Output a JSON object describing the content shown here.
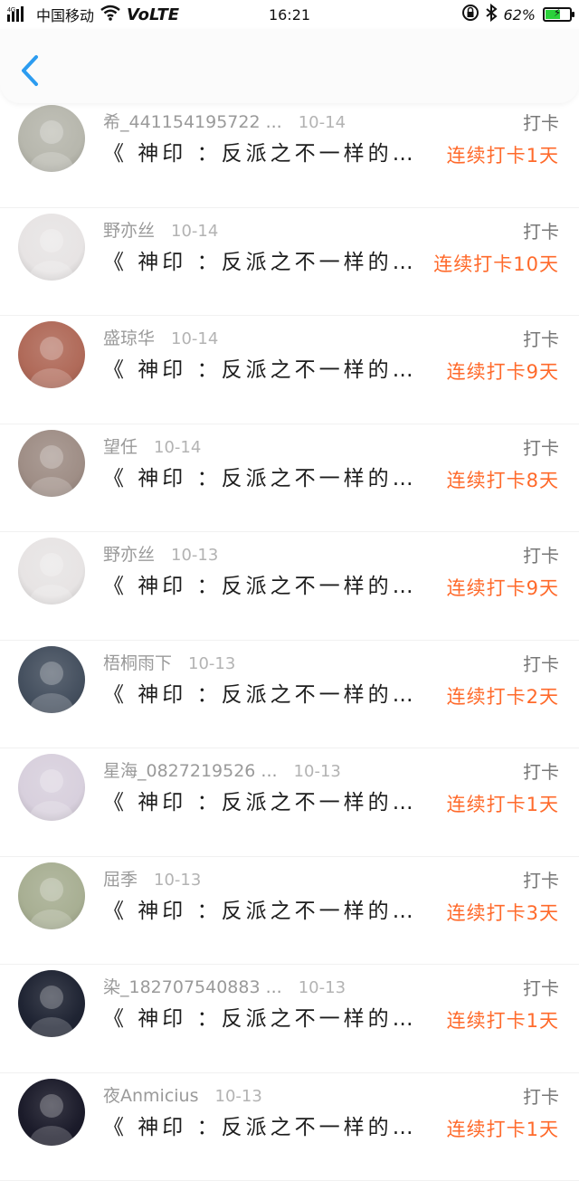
{
  "status_bar": {
    "network": "4G",
    "carrier": "中国移动",
    "volte": "VoLTE",
    "time": "16:21",
    "battery": "62%",
    "battery_level": 0.62
  },
  "header": {
    "back_icon": "chevron-left-icon"
  },
  "rows": [
    {
      "name": "希_441154195722 ...",
      "date": "10-14",
      "label": "打卡",
      "book": "《 神印 ：反派之不一样的结局 》",
      "streak": "连续打卡1天",
      "avatar_color": "#b7b7ad"
    },
    {
      "name": "野亦丝",
      "date": "10-14",
      "label": "打卡",
      "book": "《 神印 ：反派之不一样的结局 》",
      "streak": "连续打卡10天",
      "avatar_color": "#e7e4e4"
    },
    {
      "name": "盛琼华",
      "date": "10-14",
      "label": "打卡",
      "book": "《 神印 ：反派之不一样的结局 》",
      "streak": "连续打卡9天",
      "avatar_color": "#b06a59"
    },
    {
      "name": "望任",
      "date": "10-14",
      "label": "打卡",
      "book": "《 神印 ：反派之不一样的结局 》",
      "streak": "连续打卡8天",
      "avatar_color": "#9f8e86"
    },
    {
      "name": "野亦丝",
      "date": "10-13",
      "label": "打卡",
      "book": "《 神印 ：反派之不一样的结局 》",
      "streak": "连续打卡9天",
      "avatar_color": "#e7e4e4"
    },
    {
      "name": "梧桐雨下",
      "date": "10-13",
      "label": "打卡",
      "book": "《 神印 ：反派之不一样的结局 》",
      "streak": "连续打卡2天",
      "avatar_color": "#45505f"
    },
    {
      "name": "星海_0827219526 ...",
      "date": "10-13",
      "label": "打卡",
      "book": "《 神印 ：反派之不一样的结局 》",
      "streak": "连续打卡1天",
      "avatar_color": "#d8d0dd"
    },
    {
      "name": "屈季",
      "date": "10-13",
      "label": "打卡",
      "book": "《 神印 ：反派之不一样的结局 》",
      "streak": "连续打卡3天",
      "avatar_color": "#a8af93"
    },
    {
      "name": "染_182707540883 ...",
      "date": "10-13",
      "label": "打卡",
      "book": "《 神印 ：反派之不一样的结局 》",
      "streak": "连续打卡1天",
      "avatar_color": "#1f2433"
    },
    {
      "name": "夜Anmicius",
      "date": "10-13",
      "label": "打卡",
      "book": "《 神印 ：反派之不一样的结局 》",
      "streak": "连续打卡1天",
      "avatar_color": "#1b1b2a"
    }
  ]
}
